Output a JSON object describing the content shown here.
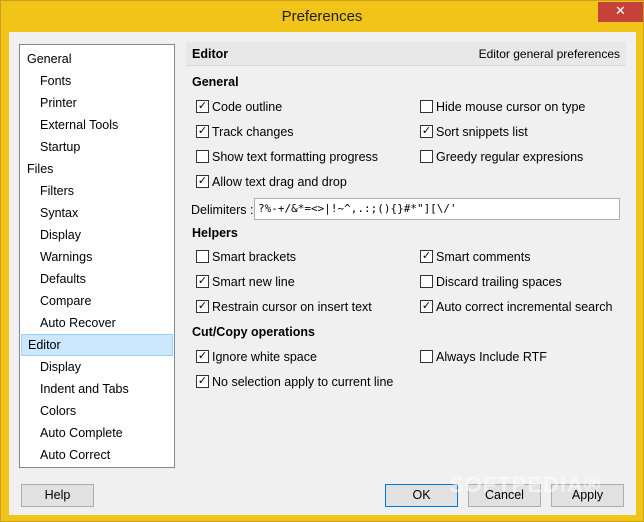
{
  "window": {
    "title": "Preferences",
    "close_label": "✕"
  },
  "tree": {
    "items": [
      {
        "label": "General",
        "level": 1
      },
      {
        "label": "Fonts",
        "level": 2
      },
      {
        "label": "Printer",
        "level": 2
      },
      {
        "label": "External Tools",
        "level": 2
      },
      {
        "label": "Startup",
        "level": 2
      },
      {
        "label": "Files",
        "level": 1
      },
      {
        "label": "Filters",
        "level": 2
      },
      {
        "label": "Syntax",
        "level": 2
      },
      {
        "label": "Display",
        "level": 2
      },
      {
        "label": "Warnings",
        "level": 2
      },
      {
        "label": "Defaults",
        "level": 2
      },
      {
        "label": "Compare",
        "level": 2
      },
      {
        "label": "Auto Recover",
        "level": 2
      },
      {
        "label": "Editor",
        "level": 1,
        "selected": true
      },
      {
        "label": "Display",
        "level": 2
      },
      {
        "label": "Indent and Tabs",
        "level": 2
      },
      {
        "label": "Colors",
        "level": 2
      },
      {
        "label": "Auto Complete",
        "level": 2
      },
      {
        "label": "Auto Correct",
        "level": 2
      }
    ]
  },
  "panel": {
    "title": "Editor",
    "description": "Editor general preferences",
    "general": {
      "heading": "General",
      "code_outline": {
        "label": "Code outline",
        "checked": true
      },
      "hide_mouse": {
        "label": "Hide mouse cursor on type",
        "checked": false
      },
      "track_changes": {
        "label": "Track changes",
        "checked": true
      },
      "sort_snippets": {
        "label": "Sort snippets list",
        "checked": true
      },
      "show_formatting": {
        "label": "Show text formatting progress",
        "checked": false
      },
      "greedy_regex": {
        "label": "Greedy regular expresions",
        "checked": false
      },
      "allow_drag": {
        "label": "Allow text drag and drop",
        "checked": true
      }
    },
    "delimiters": {
      "label": "Delimiters :",
      "value": "?%-+/&*=<>|!~^,.:;(){}#*\"][\\/'"
    },
    "helpers": {
      "heading": "Helpers",
      "smart_brackets": {
        "label": "Smart brackets",
        "checked": false
      },
      "smart_comments": {
        "label": "Smart comments",
        "checked": true
      },
      "smart_new_line": {
        "label": "Smart new line",
        "checked": true
      },
      "discard_trailing": {
        "label": "Discard trailing spaces",
        "checked": false
      },
      "restrain_cursor": {
        "label": "Restrain cursor on insert text",
        "checked": true
      },
      "auto_correct_search": {
        "label": "Auto correct incremental search",
        "checked": true
      }
    },
    "cutcopy": {
      "heading": "Cut/Copy operations",
      "ignore_white": {
        "label": "Ignore white space",
        "checked": true
      },
      "always_rtf": {
        "label": "Always Include RTF",
        "checked": false
      },
      "no_selection": {
        "label": "No selection apply to current line",
        "checked": true
      }
    }
  },
  "buttons": {
    "help": "Help",
    "ok": "OK",
    "cancel": "Cancel",
    "apply": "Apply"
  },
  "watermark": "SOFTPEDIA®",
  "colors": {
    "frame": "#f0c419",
    "selection": "#cce8ff",
    "close": "#c7413b"
  }
}
